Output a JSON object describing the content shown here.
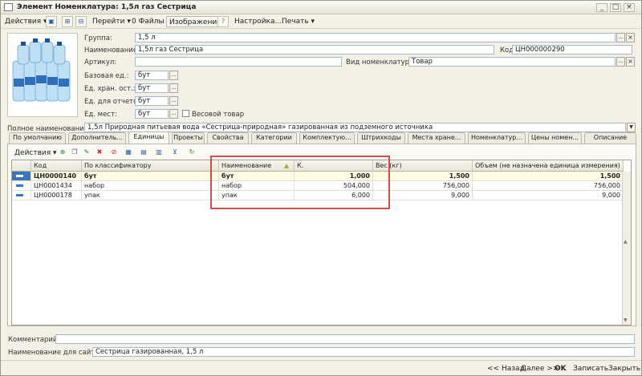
{
  "window": {
    "title": "Элемент Номенклатура: 1,5л газ Сестрица"
  },
  "toolbar": {
    "actions": "Действия",
    "goto": "Перейти",
    "files": "Файлы",
    "image": "Изображение",
    "settings": "Настройка...",
    "print": "Печать"
  },
  "form": {
    "group_label": "Группа:",
    "group_value": "1,5 л",
    "name_label": "Наименование:",
    "name_value": "1,5л газ Сестрица",
    "code_label": "Код:",
    "code_value": "ЦН000000290",
    "article_label": "Артикул:",
    "article_value": "",
    "kind_label": "Вид номенклатуры:",
    "kind_value": "Товар",
    "base_unit_label": "Базовая ед.:",
    "base_unit_value": "бут",
    "storage_unit_label": "Ед. хран. ост.:",
    "storage_unit_value": "бут",
    "report_unit_label": "Ед. для отчетов:",
    "report_unit_value": "бут",
    "place_unit_label": "Ед. мест:",
    "place_unit_value": "бут",
    "weight_item_label": "Весовой товар",
    "full_name_label": "Полное наименование:",
    "full_name_value": "1,5л Природная питьевая вода «Сестрица-природная» газированная из подземного источника"
  },
  "tabs": [
    "По умолчанию",
    "Дополнитель...",
    "Единицы",
    "Проекты",
    "Свойства",
    "Категории",
    "Комплектую...",
    "Штрихкоды",
    "Места хране...",
    "Номенклатур...",
    "Цены номен...",
    "Описание"
  ],
  "inner_toolbar": {
    "actions": "Действия"
  },
  "table": {
    "columns": [
      "Код",
      "По классификатору",
      "Наименование",
      "К.",
      "Вес (кг)",
      "Объем (не назначена единица измерения)"
    ],
    "rows": [
      {
        "code": "ЦН0000140",
        "classifier": "бут",
        "name": "бут",
        "k": "1,000",
        "weight": "1,500",
        "volume": "1,500"
      },
      {
        "code": "ЦН0001434",
        "classifier": "набор",
        "name": "набор",
        "k": "504,000",
        "weight": "756,000",
        "volume": "756,000"
      },
      {
        "code": "ЦН0000178",
        "classifier": "упак",
        "name": "упак",
        "k": "6,000",
        "weight": "9,000",
        "volume": "9,000"
      }
    ]
  },
  "footer": {
    "comment_label": "Комментарий:",
    "comment_value": "",
    "site_name_label": "Наименование для сайта:",
    "site_name_value": "Сестрица газированная, 1,5 л"
  },
  "statusbar": {
    "back": "<< Назад",
    "next": "Далее >>",
    "ok": "OK",
    "save": "Записать",
    "close": "Закрыть"
  }
}
